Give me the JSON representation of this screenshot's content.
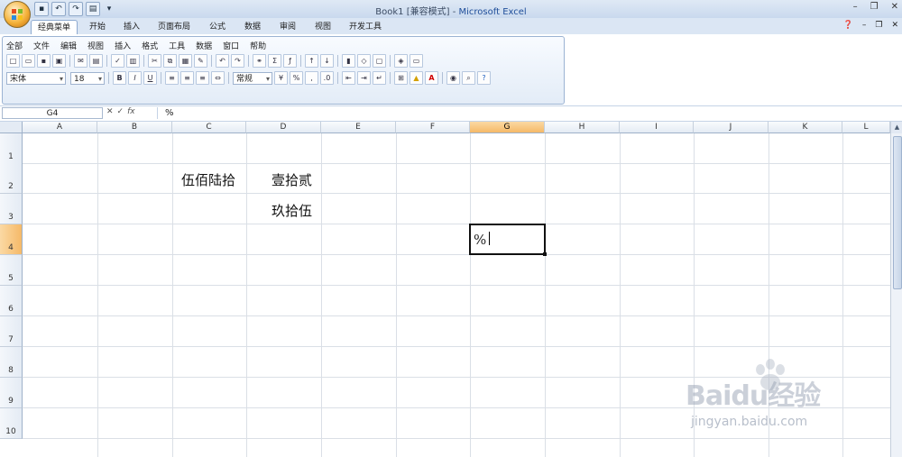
{
  "window": {
    "title_doc": "Book1",
    "title_mode": "[兼容模式]",
    "title_sep": " - ",
    "title_app": "Microsoft Excel",
    "min": "–",
    "restore": "❐",
    "close": "✕"
  },
  "tabs": [
    "经典菜单",
    "开始",
    "插入",
    "页面布局",
    "公式",
    "数据",
    "审阅",
    "视图",
    "开发工具"
  ],
  "classic_menu": [
    "全部",
    "文件",
    "编辑",
    "视图",
    "插入",
    "格式",
    "工具",
    "数据",
    "窗口",
    "帮助"
  ],
  "font": {
    "name": "宋体",
    "size": "18",
    "number_format": "常规"
  },
  "formula_bar": {
    "name_box": "G4",
    "formula": "%"
  },
  "columns": [
    "A",
    "B",
    "C",
    "D",
    "E",
    "F",
    "G",
    "H",
    "I",
    "J",
    "K",
    "L"
  ],
  "rows": [
    "1",
    "2",
    "3",
    "4",
    "5",
    "6",
    "7",
    "8",
    "9",
    "10"
  ],
  "selected": {
    "column": "G",
    "row": "4"
  },
  "cells": {
    "C2": "伍佰陆拾",
    "D2": "壹拾贰",
    "D3": "玖拾伍",
    "G4": "%"
  },
  "watermark": {
    "brand": "Baidu经验",
    "url": "jingyan.baidu.com"
  }
}
